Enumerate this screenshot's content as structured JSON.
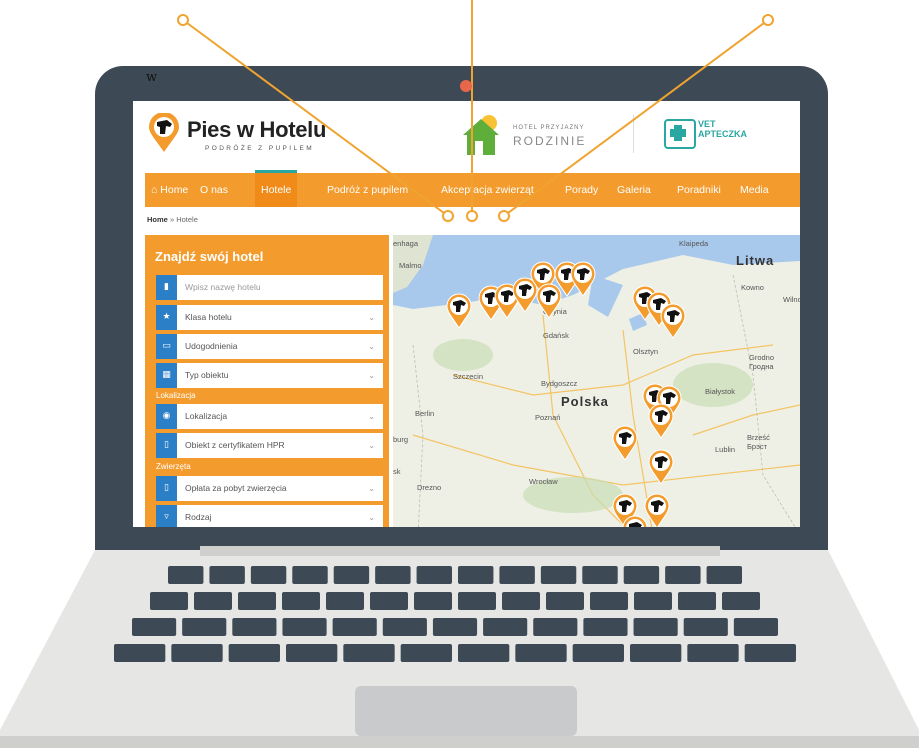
{
  "watermark": "w",
  "site": {
    "logo_title": "Pies w Hotelu",
    "logo_tagline": "PODRÓŻE Z PUPILEM",
    "partner1_top": "HOTEL PRZYJAZNY",
    "partner1_main": "RODZINIE",
    "partner2_line1": "VET",
    "partner2_line2": "APTECZKA"
  },
  "nav": {
    "items": [
      {
        "label": "Home"
      },
      {
        "label": "O nas"
      },
      {
        "label": "Hotele"
      },
      {
        "label": "Podróż z pupilem"
      },
      {
        "label": "Akceptacja zwierząt"
      },
      {
        "label": "Porady"
      },
      {
        "label": "Galeria"
      },
      {
        "label": "Poradniki"
      },
      {
        "label": "Media"
      }
    ]
  },
  "breadcrumb": {
    "home": "Home",
    "sep": "»",
    "current": "Hotele"
  },
  "sidebar": {
    "title": "Znajdź swój hotel",
    "search_placeholder": "Wpisz nazwę hotelu",
    "fields": [
      {
        "label": "Klasa hotelu",
        "icon": "star-icon"
      },
      {
        "label": "Udogodnienia",
        "icon": "tv-icon"
      },
      {
        "label": "Typ obiektu",
        "icon": "building-icon"
      }
    ],
    "section_location": "Lokalizacja",
    "location_fields": [
      {
        "label": "Lokalizacja",
        "icon": "location-icon"
      },
      {
        "label": "Obiekt z certyfikatem HPR",
        "icon": "certificate-icon"
      }
    ],
    "section_animals": "Zwierzęta",
    "animal_fields": [
      {
        "label": "Opłata za pobyt zwierzęcia",
        "icon": "fee-icon"
      },
      {
        "label": "Rodzaj",
        "icon": "type-icon"
      }
    ]
  },
  "map": {
    "labels": [
      "enhaga",
      "Malmo",
      "Klaipeda",
      "Litwa",
      "Kowno",
      "Wilno",
      "Gdynia",
      "Gdańsk",
      "Olsztyn",
      "Grodno",
      "Гродна",
      "Szczecin",
      "Bydgoszcz",
      "Polska",
      "Białystok",
      "Berlin",
      "Poznań",
      "Brześć",
      "Брэст",
      "Lublin",
      "Drezno",
      "Wrocław",
      "burg",
      "sk"
    ]
  },
  "colors": {
    "brand_orange": "#f39b2c",
    "field_icon_blue": "#2b7fc7",
    "accent_teal": "#2aa7a1",
    "laptop_frame": "#3d4a55",
    "callout_line": "#f0a32f"
  }
}
